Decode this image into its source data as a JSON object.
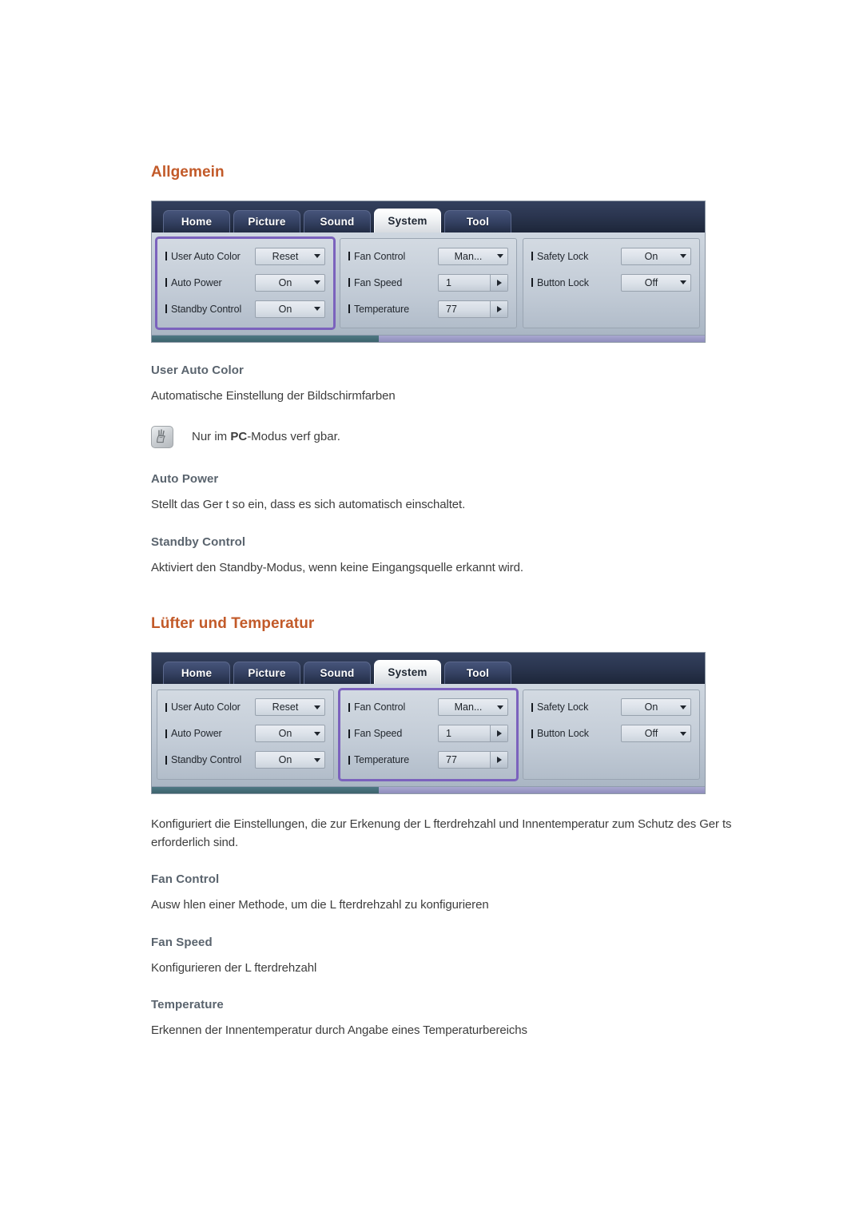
{
  "colors": {
    "heading": "#c25a29",
    "subheading": "#5a646e",
    "body": "#3d3d3d",
    "highlight_outline": "#7b62bd",
    "tabbar": "#2b3650"
  },
  "sections": [
    {
      "title": "Allgemein",
      "osd": {
        "tabs": [
          {
            "label": "Home",
            "active": false
          },
          {
            "label": "Picture",
            "active": false
          },
          {
            "label": "Sound",
            "active": false
          },
          {
            "label": "System",
            "active": true
          },
          {
            "label": "Tool",
            "active": false
          }
        ],
        "groups": [
          {
            "highlighted": true,
            "rows": [
              {
                "label": "User Auto Color",
                "type": "combo",
                "value": "Reset"
              },
              {
                "label": "Auto Power",
                "type": "combo",
                "value": "On"
              },
              {
                "label": "Standby Control",
                "type": "combo",
                "value": "On"
              }
            ]
          },
          {
            "highlighted": false,
            "rows": [
              {
                "label": "Fan Control",
                "type": "combo",
                "value": "Man..."
              },
              {
                "label": "Fan Speed",
                "type": "spin",
                "value": "1"
              },
              {
                "label": "Temperature",
                "type": "spin",
                "value": "77"
              }
            ]
          },
          {
            "highlighted": false,
            "rows": [
              {
                "label": "Safety Lock",
                "type": "combo",
                "value": "On"
              },
              {
                "label": "Button Lock",
                "type": "combo",
                "value": "Off"
              }
            ]
          }
        ]
      },
      "items": [
        {
          "heading": "User Auto Color",
          "text": "Automatische Einstellung der Bildschirmfarben",
          "note": {
            "prefix": "Nur im ",
            "bold": "PC",
            "suffix": "-Modus verf gbar."
          }
        },
        {
          "heading": "Auto Power",
          "text": "Stellt das Ger t so ein, dass es sich automatisch einschaltet."
        },
        {
          "heading": "Standby Control",
          "text": "Aktiviert den Standby-Modus, wenn keine Eingangsquelle erkannt wird."
        }
      ]
    },
    {
      "title": "Lüfter und Temperatur",
      "osd": {
        "tabs": [
          {
            "label": "Home",
            "active": false
          },
          {
            "label": "Picture",
            "active": false
          },
          {
            "label": "Sound",
            "active": false
          },
          {
            "label": "System",
            "active": true
          },
          {
            "label": "Tool",
            "active": false
          }
        ],
        "groups": [
          {
            "highlighted": false,
            "rows": [
              {
                "label": "User Auto Color",
                "type": "combo",
                "value": "Reset"
              },
              {
                "label": "Auto Power",
                "type": "combo",
                "value": "On"
              },
              {
                "label": "Standby Control",
                "type": "combo",
                "value": "On"
              }
            ]
          },
          {
            "highlighted": true,
            "rows": [
              {
                "label": "Fan Control",
                "type": "combo",
                "value": "Man..."
              },
              {
                "label": "Fan Speed",
                "type": "spin",
                "value": "1"
              },
              {
                "label": "Temperature",
                "type": "spin",
                "value": "77"
              }
            ]
          },
          {
            "highlighted": false,
            "rows": [
              {
                "label": "Safety Lock",
                "type": "combo",
                "value": "On"
              },
              {
                "label": "Button Lock",
                "type": "combo",
                "value": "Off"
              }
            ]
          }
        ]
      },
      "intro": "Konfiguriert die Einstellungen, die zur Erkenung der L fterdrehzahl und Innentemperatur zum Schutz des Ger ts erforderlich sind.",
      "items": [
        {
          "heading": "Fan Control",
          "text": "Ausw hlen einer Methode, um die L fterdrehzahl zu konfigurieren"
        },
        {
          "heading": "Fan Speed",
          "text": "Konfigurieren der L fterdrehzahl"
        },
        {
          "heading": "Temperature",
          "text": "Erkennen der Innentemperatur durch Angabe eines Temperaturbereichs"
        }
      ]
    }
  ],
  "icons": {
    "note": "note-pen-icon",
    "caret_down": "chevron-down-icon",
    "caret_right": "chevron-right-icon"
  }
}
